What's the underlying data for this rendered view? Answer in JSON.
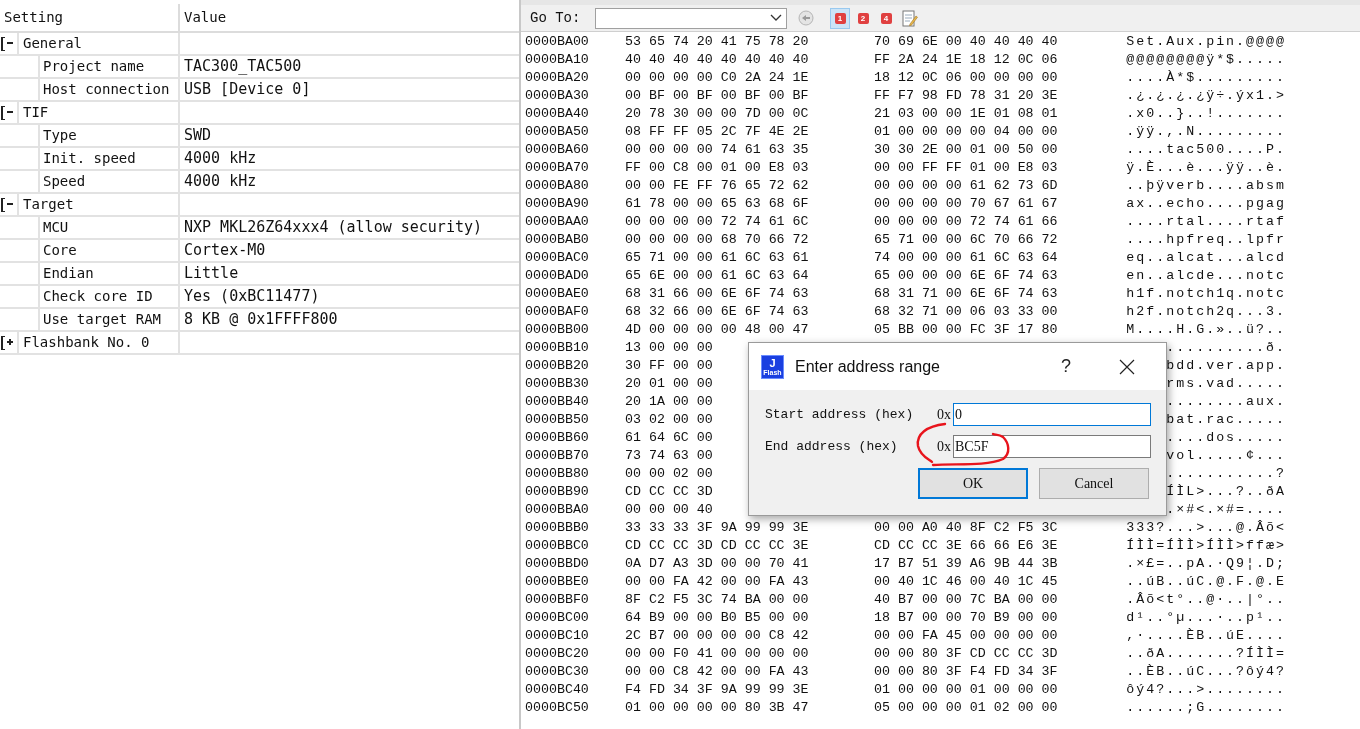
{
  "settings_panel": {
    "columns": [
      "Setting",
      "Value"
    ],
    "groups": [
      {
        "label": "General",
        "expanded": true,
        "children": [
          {
            "setting": "Project name",
            "value": "TAC300_TAC500"
          },
          {
            "setting": "Host connection",
            "value": "USB [Device 0]"
          }
        ]
      },
      {
        "label": "TIF",
        "expanded": true,
        "children": [
          {
            "setting": "Type",
            "value": "SWD"
          },
          {
            "setting": "Init. speed",
            "value": "4000 kHz"
          },
          {
            "setting": "Speed",
            "value": "4000 kHz"
          }
        ]
      },
      {
        "label": "Target",
        "expanded": true,
        "children": [
          {
            "setting": "MCU",
            "value": "NXP MKL26Z64xxx4 (allow security)"
          },
          {
            "setting": "Core",
            "value": "Cortex-M0"
          },
          {
            "setting": "Endian",
            "value": "Little"
          },
          {
            "setting": "Check core ID",
            "value": "Yes (0xBC11477)"
          },
          {
            "setting": "Use target RAM",
            "value": "8 KB @ 0x1FFFF800"
          }
        ]
      },
      {
        "label": "Flashbank No. 0",
        "expanded": false
      }
    ]
  },
  "toolbar": {
    "goto_label": "Go To:",
    "view_buttons": [
      {
        "label": "1",
        "selected": true
      },
      {
        "label": "2",
        "selected": false
      },
      {
        "label": "4",
        "selected": false
      }
    ]
  },
  "hex_view": {
    "rows": [
      {
        "address": "0000BA00",
        "bytes": "53 65 74 20 41 75 78 20 70 69 6E 00 40 40 40 40",
        "ascii": "Set.Aux.pin.@@@@"
      },
      {
        "address": "0000BA10",
        "bytes": "40 40 40 40 40 40 40 40 FF 2A 24 1E 18 12 0C 06",
        "ascii": "@@@@@@@@ÿ*$....."
      },
      {
        "address": "0000BA20",
        "bytes": "00 00 00 00 C0 2A 24 1E 18 12 0C 06 00 00 00 00",
        "ascii": "....À*$........."
      },
      {
        "address": "0000BA30",
        "bytes": "00 BF 00 BF 00 BF 00 BF FF F7 98 FD 78 31 20 3E",
        "ascii": ".¿.¿.¿.¿ÿ÷.ýx1.>"
      },
      {
        "address": "0000BA40",
        "bytes": "20 78 30 00 00 7D 00 0C 21 03 00 00 1E 01 08 01",
        "ascii": ".x0..}..!......."
      },
      {
        "address": "0000BA50",
        "bytes": "08 FF FF 05 2C 7F 4E 2E 01 00 00 00 00 04 00 00",
        "ascii": ".ÿÿ.,.N........."
      },
      {
        "address": "0000BA60",
        "bytes": "00 00 00 00 74 61 63 35 30 30 2E 00 01 00 50 00",
        "ascii": "....tac500....P."
      },
      {
        "address": "0000BA70",
        "bytes": "FF 00 C8 00 01 00 E8 03 00 00 FF FF 01 00 E8 03",
        "ascii": "ÿ.È...è...ÿÿ..è."
      },
      {
        "address": "0000BA80",
        "bytes": "00 00 FE FF 76 65 72 62 00 00 00 00 61 62 73 6D",
        "ascii": "..þÿverb....absm"
      },
      {
        "address": "0000BA90",
        "bytes": "61 78 00 00 65 63 68 6F 00 00 00 00 70 67 61 67",
        "ascii": "ax..echo....pgag"
      },
      {
        "address": "0000BAA0",
        "bytes": "00 00 00 00 72 74 61 6C 00 00 00 00 72 74 61 66",
        "ascii": "....rtal....rtaf"
      },
      {
        "address": "0000BAB0",
        "bytes": "00 00 00 00 68 70 66 72 65 71 00 00 6C 70 66 72",
        "ascii": "....hpfreq..lpfr"
      },
      {
        "address": "0000BAC0",
        "bytes": "65 71 00 00 61 6C 63 61 74 00 00 00 61 6C 63 64",
        "ascii": "eq..alcat...alcd"
      },
      {
        "address": "0000BAD0",
        "bytes": "65 6E 00 00 61 6C 63 64 65 00 00 00 6E 6F 74 63",
        "ascii": "en..alcde...notc"
      },
      {
        "address": "0000BAE0",
        "bytes": "68 31 66 00 6E 6F 74 63 68 31 71 00 6E 6F 74 63",
        "ascii": "h1f.notch1q.notc"
      },
      {
        "address": "0000BAF0",
        "bytes": "68 32 66 00 6E 6F 74 63 68 32 71 00 06 03 33 00",
        "ascii": "h2f.notch2q...3."
      },
      {
        "address": "0000BB00",
        "bytes": "4D 00 00 00 00 48 00 47 05 BB 00 00 FC 3F 17 80",
        "ascii": "M....H.G.»..ü?.."
      },
      {
        "address": "0000BB10",
        "bytes": "13 00 00 00",
        "ascii": "..........ð."
      },
      {
        "address": "0000BB20",
        "bytes": "30 FF 00 00",
        "ascii": "bdd.ver.app."
      },
      {
        "address": "0000BB30",
        "bytes": "20 01 00 00",
        "ascii": "rms.vad....."
      },
      {
        "address": "0000BB40",
        "bytes": "20 1A 00 00",
        "ascii": "........aux."
      },
      {
        "address": "0000BB50",
        "bytes": "03 02 00 00",
        "ascii": "bat.rac....."
      },
      {
        "address": "0000BB60",
        "bytes": "61 64 6C 00",
        "ascii": "....dos....."
      },
      {
        "address": "0000BB70",
        "bytes": "73 74 63 00",
        "ascii": "vol.....¢..."
      },
      {
        "address": "0000BB80",
        "bytes": "00 00 02 00",
        "ascii": "...........?"
      },
      {
        "address": "0000BB90",
        "bytes": "CD CC CC 3D",
        "ascii": "ÍÌL>...?..ðA"
      },
      {
        "address": "0000BBA0",
        "bytes": "00 00 00 40",
        "ascii": ".×#<.×#=...."
      },
      {
        "address": "0000BBB0",
        "bytes": "33 33 33 3F 9A 99 99 3E 00 00 A0 40 8F C2 F5 3C",
        "ascii": "333?...>...@.Âõ<"
      },
      {
        "address": "0000BBC0",
        "bytes": "CD CC CC 3D CD CC CC 3E CD CC CC 3E 66 66 E6 3E",
        "ascii": "ÍÌÌ=ÍÌÌ>ÍÌÌ>ffæ>"
      },
      {
        "address": "0000BBD0",
        "bytes": "0A D7 A3 3D 00 00 70 41 17 B7 51 39 A6 9B 44 3B",
        "ascii": ".×£=..pA.·Q9¦.D;"
      },
      {
        "address": "0000BBE0",
        "bytes": "00 00 FA 42 00 00 FA 43 00 40 1C 46 00 40 1C 45",
        "ascii": "..úB..úC.@.F.@.E"
      },
      {
        "address": "0000BBF0",
        "bytes": "8F C2 F5 3C 74 BA 00 00 40 B7 00 00 7C BA 00 00",
        "ascii": ".Âõ<t°..@·..|°.."
      },
      {
        "address": "0000BC00",
        "bytes": "64 B9 00 00 B0 B5 00 00 18 B7 00 00 70 B9 00 00",
        "ascii": "d¹..°µ...·..p¹.."
      },
      {
        "address": "0000BC10",
        "bytes": "2C B7 00 00 00 00 C8 42 00 00 FA 45 00 00 00 00",
        "ascii": ",·....ÈB..úE...."
      },
      {
        "address": "0000BC20",
        "bytes": "00 00 F0 41 00 00 00 00 00 00 80 3F CD CC CC 3D",
        "ascii": "..ðA.......?ÍÌÌ="
      },
      {
        "address": "0000BC30",
        "bytes": "00 00 C8 42 00 00 FA 43 00 00 80 3F F4 FD 34 3F",
        "ascii": "..ÈB..úC...?ôý4?"
      },
      {
        "address": "0000BC40",
        "bytes": "F4 FD 34 3F 9A 99 99 3E 01 00 00 00 01 00 00 00",
        "ascii": "ôý4?...>........"
      },
      {
        "address": "0000BC50",
        "bytes": "01 00 00 00 00 80 3B 47 05 00 00 00 01 02 00 00",
        "ascii": "......;G........"
      }
    ]
  },
  "dialog": {
    "logo_letter": "J",
    "logo_caption": "Flash",
    "title": "Enter address range",
    "help": "?",
    "fields": [
      {
        "label": "Start address (hex)",
        "prefix": "0x",
        "value": "0",
        "focused": true
      },
      {
        "label": "End address (hex)",
        "prefix": "0x",
        "value": "BC5F",
        "focused": false
      }
    ],
    "buttons": [
      {
        "label": "OK",
        "default": true
      },
      {
        "label": "Cancel",
        "default": false
      }
    ]
  }
}
